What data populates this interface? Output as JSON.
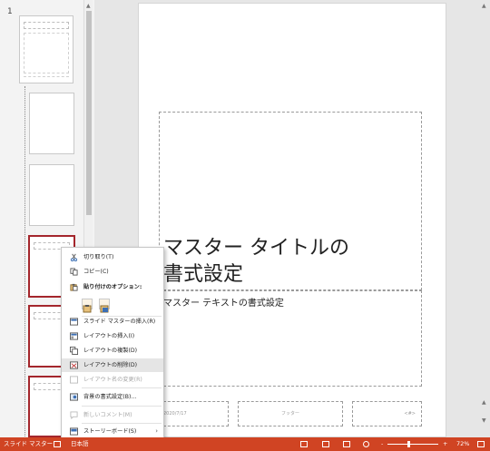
{
  "thumbnails": {
    "slide_number": "1"
  },
  "slide": {
    "title": "マスター タイトルの\n書式設定",
    "body": "マスター テキストの書式設定",
    "footer_date": "2020/7/17",
    "footer_text": "フッター",
    "footer_number": "<#>"
  },
  "context_menu": {
    "items": [
      {
        "label": "切り取り(T)",
        "icon": "scissors-icon",
        "enabled": true
      },
      {
        "label": "コピー(C)",
        "icon": "copy-icon",
        "enabled": true
      },
      {
        "label": "貼り付けのオプション:",
        "icon": "paste-icon",
        "enabled": true
      },
      {
        "label": "スライド マスターの挿入(R)",
        "icon": "insert-master-icon",
        "enabled": true
      },
      {
        "label": "レイアウトの挿入(I)",
        "icon": "insert-layout-icon",
        "enabled": true
      },
      {
        "label": "レイアウトの複製(D)",
        "icon": "duplicate-layout-icon",
        "enabled": true
      },
      {
        "label": "レイアウトの削除(D)",
        "icon": "delete-layout-icon",
        "enabled": true,
        "highlighted": true
      },
      {
        "label": "レイアウト名の変更(R)",
        "icon": "rename-layout-icon",
        "enabled": false
      },
      {
        "label": "背景の書式設定(B)...",
        "icon": "format-background-icon",
        "enabled": true
      },
      {
        "label": "新しいコメント(M)",
        "icon": "comment-icon",
        "enabled": false
      },
      {
        "label": "ストーリーボード(S)",
        "icon": "storyboard-icon",
        "enabled": true,
        "submenu": true
      }
    ]
  },
  "status_bar": {
    "view_label": "スライド マスター",
    "language": "日本語",
    "zoom": "72%",
    "zoom_minus": "-",
    "zoom_plus": "+"
  },
  "colors": {
    "accent": "#d04423",
    "selection": "#a4262c"
  }
}
